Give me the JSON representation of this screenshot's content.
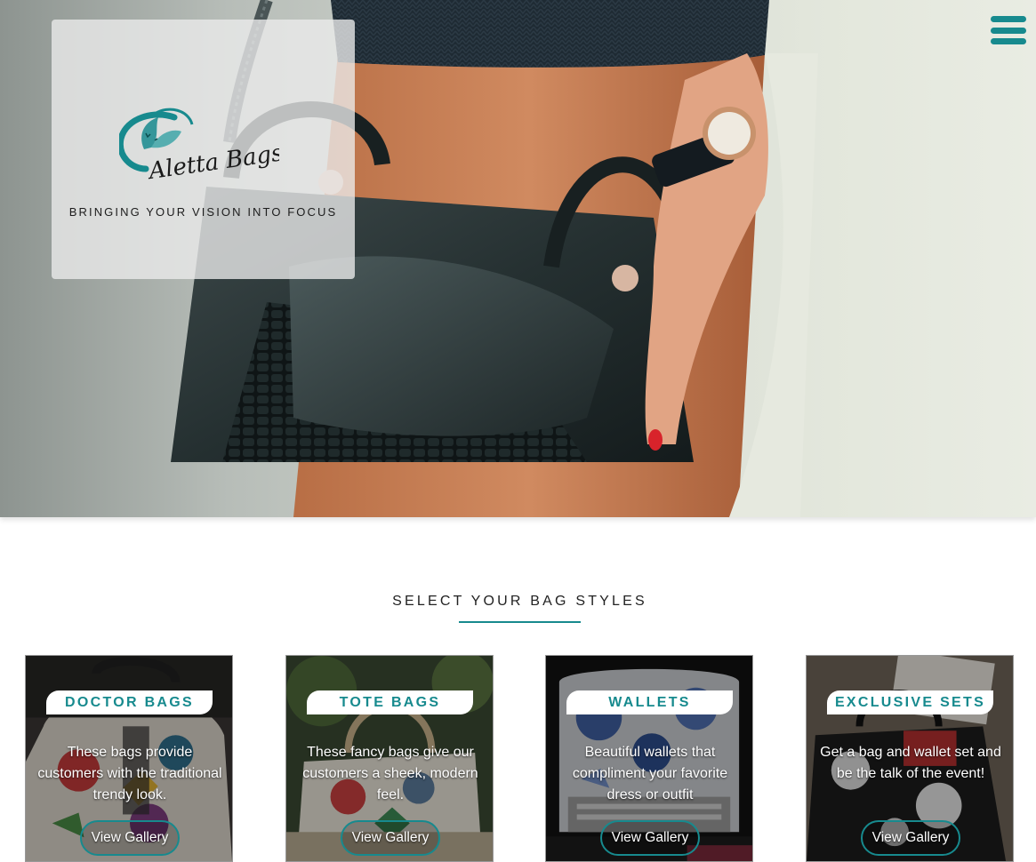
{
  "brand": {
    "logo_text": "Aletta Bags",
    "tagline": "BRINGING YOUR VISION INTO FOCUS"
  },
  "nav": {
    "menu_icon": "hamburger-menu-icon"
  },
  "colors": {
    "accent": "#178a8e",
    "card_label_bg": "#ffffff",
    "text_dark": "#222222"
  },
  "section": {
    "title": "SELECT YOUR BAG STYLES"
  },
  "cards": [
    {
      "title": "DOCTOR BAGS",
      "description": "These bags provide customers with the traditional trendy look.",
      "button": "View Gallery"
    },
    {
      "title": "TOTE BAGS",
      "description": "These fancy bags give our customers a sheek, modern feel.",
      "button": "View Gallery"
    },
    {
      "title": "WALLETS",
      "description": "Beautiful wallets that compliment your favorite dress or outfit",
      "button": "View Gallery"
    },
    {
      "title": "EXCLUSIVE SETS",
      "description": "Get a bag and wallet set and be the talk of the event!",
      "button": "View Gallery"
    }
  ]
}
